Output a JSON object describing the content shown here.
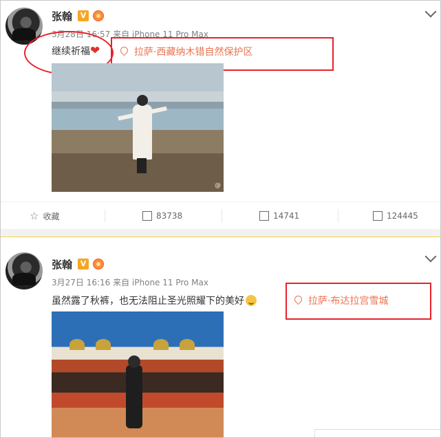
{
  "posts": [
    {
      "name": "张翰",
      "verified": "V",
      "meta": "3月28日 16:57 来自 iPhone 11 Pro Max",
      "text": "继续祈福",
      "location": "拉萨·西藏纳木错自然保护区",
      "watermark": "@"
    },
    {
      "name": "张翰",
      "verified": "V",
      "meta": "3月27日 16:16 来自 iPhone 11 Pro Max",
      "text": "虽然露了秋裤，也无法阻止圣光照耀下的美好",
      "location": "拉萨·布达拉宫雪城"
    }
  ],
  "actions": {
    "favorite": "收藏",
    "repost": "83738",
    "comment": "14741",
    "like": "124445"
  },
  "colors": {
    "accent": "#eb7350",
    "highlight": "#e8202a",
    "separator": "#ffcf33"
  },
  "icons": [
    "star-icon",
    "repost-icon",
    "comment-icon",
    "like-icon",
    "location-pin-icon",
    "chevron-down-icon",
    "heart-icon",
    "smile-emoji-icon"
  ]
}
